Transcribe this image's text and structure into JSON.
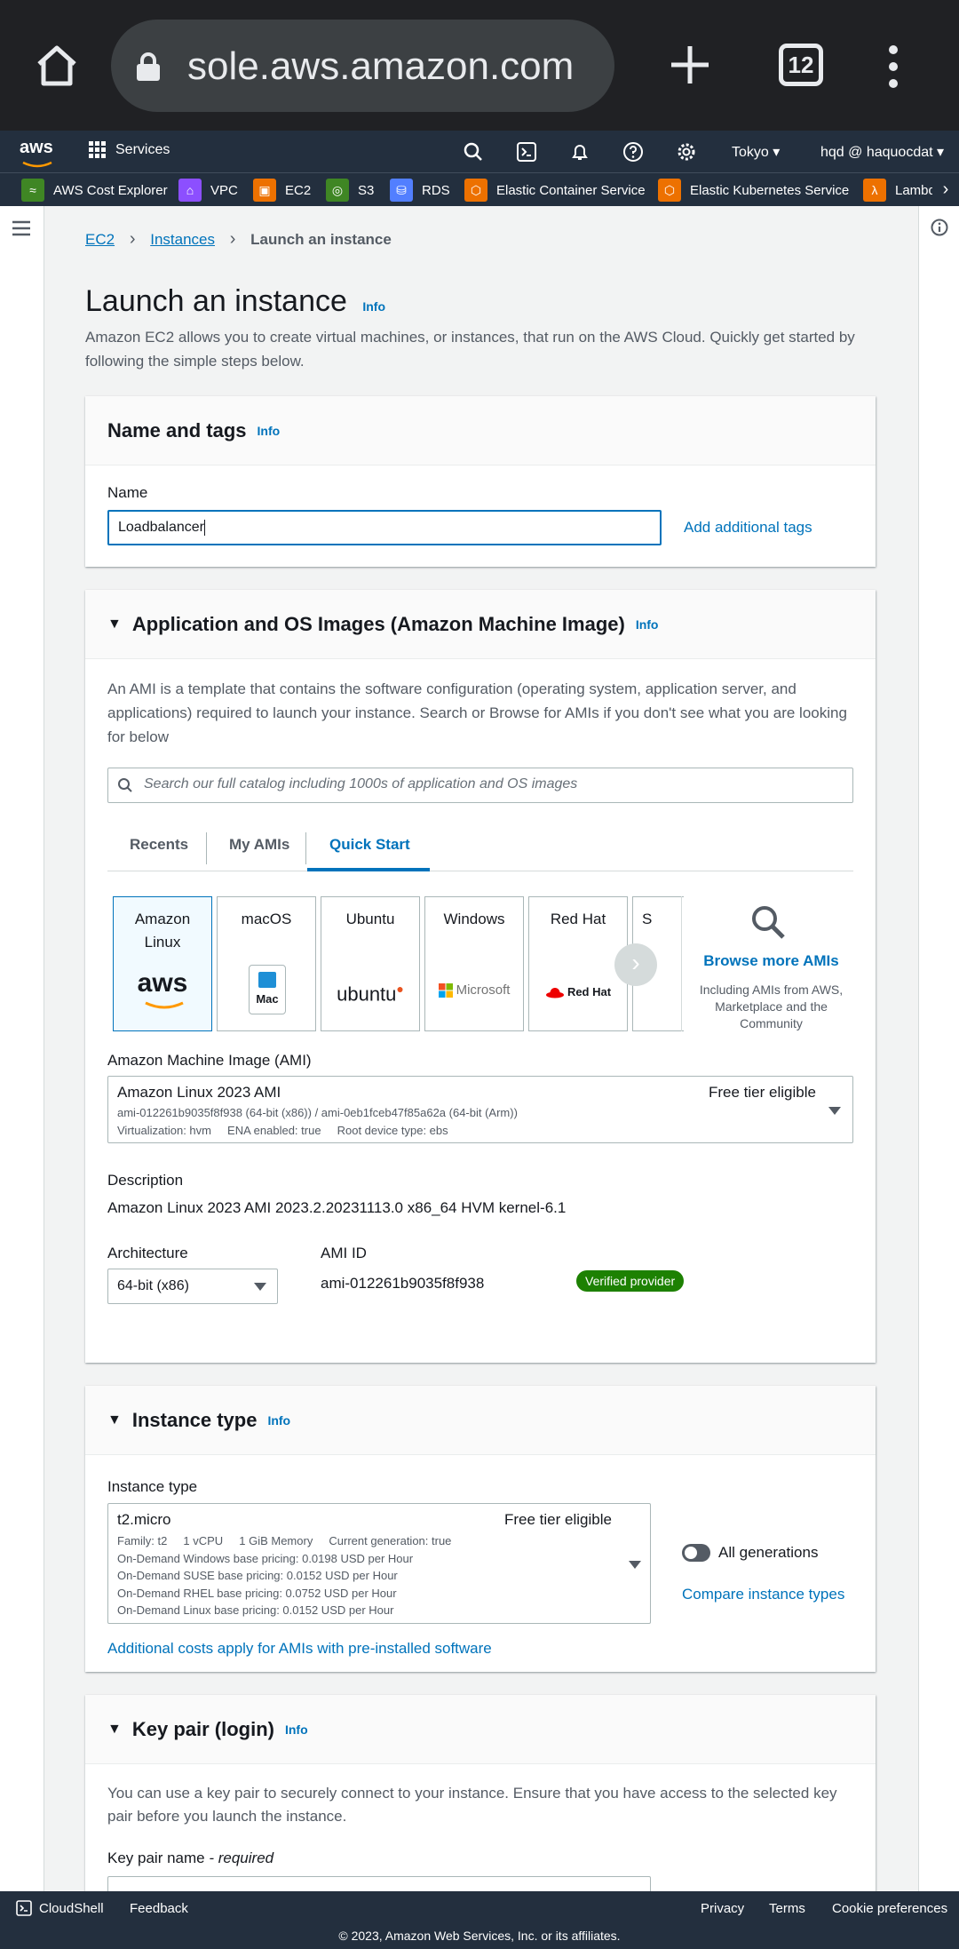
{
  "browser": {
    "url": "sole.aws.amazon.com",
    "tab_count": "12"
  },
  "aws_nav": {
    "logo": "aws",
    "services": "Services",
    "region": "Tokyo ▾",
    "user": "hqd @ haquocdat ▾"
  },
  "favorites": [
    {
      "label": "AWS Cost Explorer",
      "color": "#3f8624"
    },
    {
      "label": "VPC",
      "color": "#8c4fff"
    },
    {
      "label": "EC2",
      "color": "#ed7100"
    },
    {
      "label": "S3",
      "color": "#3f8624"
    },
    {
      "label": "RDS",
      "color": "#527fff"
    },
    {
      "label": "Elastic Container Service",
      "color": "#ed7100"
    },
    {
      "label": "Elastic Kubernetes Service",
      "color": "#ed7100"
    },
    {
      "label": "Lambda",
      "color": "#ed7100"
    }
  ],
  "breadcrumb": {
    "ec2": "EC2",
    "instances": "Instances",
    "current": "Launch an instance"
  },
  "page": {
    "title": "Launch an instance",
    "info": "Info",
    "lead": "Amazon EC2 allows you to create virtual machines, or instances, that run on the AWS Cloud. Quickly get started by following the simple steps below."
  },
  "name_tags": {
    "heading": "Name and tags",
    "name_label": "Name",
    "name_value": "Loadbalancer",
    "add_tags": "Add additional tags"
  },
  "ami": {
    "heading": "Application and OS Images (Amazon Machine Image)",
    "desc": "An AMI is a template that contains the software configuration (operating system, application server, and applications) required to launch your instance. Search or Browse for AMIs if you don't see what you are looking for below",
    "search_placeholder": "Search our full catalog including 1000s of application and OS images",
    "tabs": [
      "Recents",
      "My AMIs",
      "Quick Start"
    ],
    "cards": [
      "Amazon Linux",
      "macOS",
      "Ubuntu",
      "Windows",
      "Red Hat",
      "S"
    ],
    "brands": {
      "aws": "aws",
      "mac": "Mac",
      "ubuntu": "ubuntu",
      "microsoft": "Microsoft",
      "redhat": "Red Hat"
    },
    "browse": "Browse more AMIs",
    "browse_sub": "Including AMIs from AWS, Marketplace and the Community",
    "ami_label": "Amazon Machine Image (AMI)",
    "ami_name": "Amazon Linux 2023 AMI",
    "ami_free": "Free tier eligible",
    "ami_ids": "ami-012261b9035f8f938 (64-bit (x86)) / ami-0eb1fceb47f85a62a (64-bit (Arm))",
    "ami_meta": "Virtualization: hvm     ENA enabled: true     Root device type: ebs",
    "description_label": "Description",
    "description": "Amazon Linux 2023 AMI 2023.2.20231113.0 x86_64 HVM kernel-6.1",
    "arch_label": "Architecture",
    "arch_value": "64-bit (x86)",
    "amiid_label": "AMI ID",
    "amiid_value": "ami-012261b9035f8f938",
    "verified": "Verified provider"
  },
  "instance_type": {
    "heading": "Instance type",
    "label": "Instance type",
    "value": "t2.micro",
    "free": "Free tier eligible",
    "family": "Family: t2     1 vCPU     1 GiB Memory     Current generation: true",
    "windows": "On-Demand Windows base pricing: 0.0198 USD per Hour",
    "suse": "On-Demand SUSE base pricing: 0.0152 USD per Hour",
    "rhel": "On-Demand RHEL base pricing: 0.0752 USD per Hour",
    "linux": "On-Demand Linux base pricing: 0.0152 USD per Hour",
    "all_gen": "All generations",
    "compare": "Compare instance types",
    "additional": "Additional costs apply for AMIs with pre-installed software"
  },
  "key_pair": {
    "heading": "Key pair (login)",
    "desc": "You can use a key pair to securely connect to your instance. Ensure that you have access to the selected key pair before you launch the instance.",
    "label": "Key pair name",
    "required": " - required"
  },
  "footer": {
    "cloudshell": "CloudShell",
    "feedback": "Feedback",
    "privacy": "Privacy",
    "terms": "Terms",
    "cookies": "Cookie preferences",
    "copyright": "© 2023, Amazon Web Services, Inc. or its affiliates."
  }
}
